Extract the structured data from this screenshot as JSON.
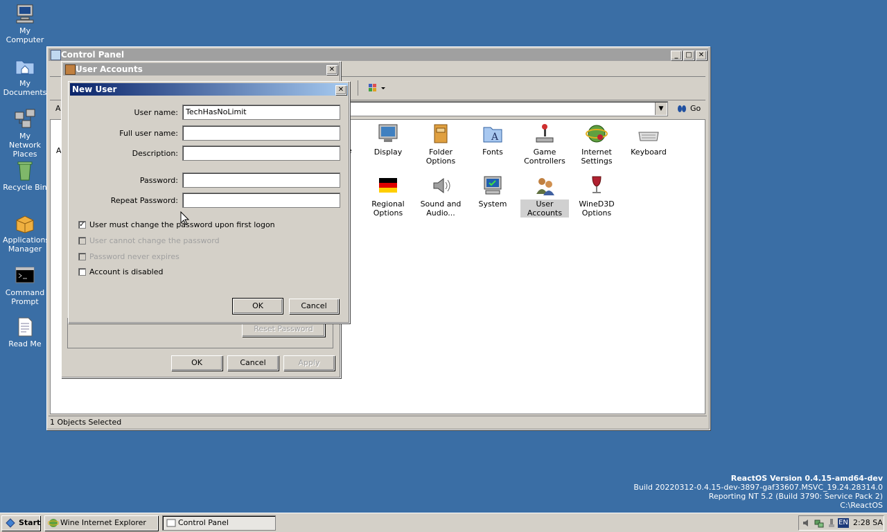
{
  "desktop": {
    "icons": [
      {
        "label": "My Computer"
      },
      {
        "label": "My Documents"
      },
      {
        "label": "My Network Places"
      },
      {
        "label": "Recycle Bin"
      },
      {
        "label": "Applications Manager"
      },
      {
        "label": "Command Prompt"
      },
      {
        "label": "Read Me"
      }
    ],
    "version": {
      "line1": "ReactOS Version 0.4.15-amd64-dev",
      "line2": "Build 20220312-0.4.15-dev-3897-gaf33607.MSVC_19.24.28314.0",
      "line3": "Reporting NT 5.2 (Build 3790: Service Pack 2)",
      "line4": "C:\\ReactOS"
    }
  },
  "control_panel": {
    "title": "Control Panel",
    "address_prefix": "A",
    "go_label": "Go",
    "left_letter": "A",
    "partial_label": "e",
    "status": "1 Objects Selected",
    "items": [
      {
        "label": "Display"
      },
      {
        "label": "Folder Options"
      },
      {
        "label": "Fonts"
      },
      {
        "label": "Game Controllers"
      },
      {
        "label": "Internet Settings"
      },
      {
        "label": "Keyboard"
      },
      {
        "label": "Regional Options"
      },
      {
        "label": "Sound and Audio..."
      },
      {
        "label": "System"
      },
      {
        "label": "User Accounts"
      },
      {
        "label": "WineD3D Options"
      }
    ]
  },
  "user_accounts": {
    "title": "User Accounts",
    "reset_password": "Reset Password",
    "ok": "OK",
    "cancel": "Cancel",
    "apply": "Apply"
  },
  "new_user": {
    "title": "New User",
    "username_label": "User name:",
    "username_value": "TechHasNoLimit",
    "fullname_label": "Full user name:",
    "description_label": "Description:",
    "password_label": "Password:",
    "repeat_password_label": "Repeat Password:",
    "chk_must_change": "User must change the password upon first logon",
    "chk_cannot_change": "User cannot change the password",
    "chk_never_expires": "Password never expires",
    "chk_disabled": "Account is disabled",
    "ok": "OK",
    "cancel": "Cancel"
  },
  "taskbar": {
    "start": "Start",
    "tasks": [
      {
        "label": "Wine Internet Explorer"
      },
      {
        "label": "Control Panel"
      }
    ],
    "lang": "EN",
    "clock": "2:28 SA"
  }
}
